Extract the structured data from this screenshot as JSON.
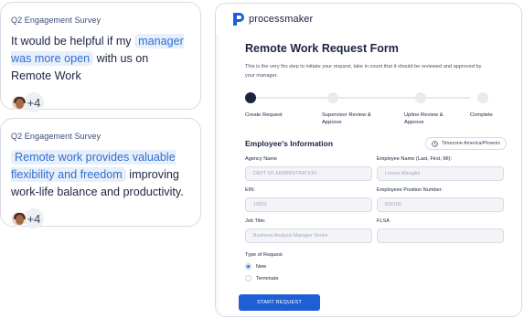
{
  "survey_cards": [
    {
      "kicker": "Q2 Engagement Survey",
      "text_before": "It would be helpful if my ",
      "highlight": "manager was more open",
      "text_after": " with us on Remote Work",
      "more_count": "+4"
    },
    {
      "kicker": "Q2 Engagement Survey",
      "text_before": "",
      "highlight": "Remote work provides valuable flexibility and freedom",
      "text_after": " improving work-life balance and productivity.",
      "more_count": "+4"
    }
  ],
  "app": {
    "brand": "processmaker",
    "form_title": "Remote Work Request Form",
    "form_description": "This is the very firs step to initiate your request, take in count that it should be reviewed and approved by your manager.",
    "steps": [
      {
        "label": "Create Request",
        "active": true
      },
      {
        "label": "Supervisor Review & Approve",
        "active": false
      },
      {
        "label": "Upline Review & Approve",
        "active": false
      },
      {
        "label": "Complete",
        "active": false
      }
    ],
    "section_title": "Employee's Information",
    "timezone": "Timezone America/Phoenix",
    "fields": [
      {
        "label": "Agency Name",
        "value": "DEPT OF ADMINISTRATION"
      },
      {
        "label": "Employee Name (Last, First, MI):",
        "value": "Lorena Maraglia"
      },
      {
        "label": "EIN:",
        "value": "19923"
      },
      {
        "label": "Employees Position Number:",
        "value": "818180"
      },
      {
        "label": "Job Title:",
        "value": "Business Analysis Manager Senior"
      },
      {
        "label": "FLSA",
        "value": ""
      }
    ],
    "request_type_label": "Type of Request",
    "request_options": [
      {
        "label": "New",
        "checked": true
      },
      {
        "label": "Terminate",
        "checked": false
      }
    ],
    "start_button": "START REQUEST"
  },
  "colors": {
    "accent_blue": "#1f5fd6",
    "highlight_bg": "#e7effb",
    "highlight_text": "#2f6fd1",
    "navy_text": "#1b2340"
  }
}
